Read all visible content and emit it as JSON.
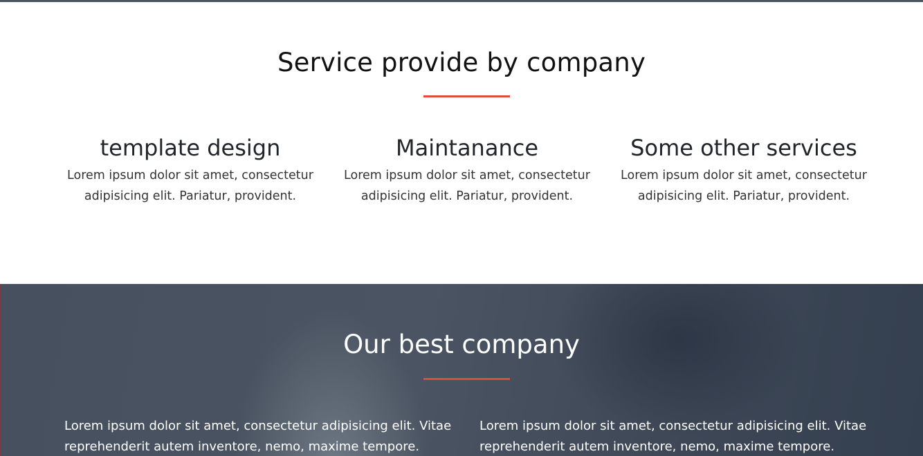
{
  "colors": {
    "accent": "#e04b3a",
    "dark_band": "#46505e",
    "top_border": "#4b5560"
  },
  "services": {
    "title": "Service provide by company",
    "items": [
      {
        "title": "template design",
        "text": "Lorem ipsum dolor sit amet, consectetur adipisicing elit. Pariatur, provident."
      },
      {
        "title": "Maintanance",
        "text": "Lorem ipsum dolor sit amet, consectetur adipisicing elit. Pariatur, provident."
      },
      {
        "title": "Some other services",
        "text": "Lorem ipsum dolor sit amet, consectetur adipisicing elit. Pariatur, provident."
      }
    ]
  },
  "company": {
    "title": "Our best company",
    "columns": [
      "Lorem ipsum dolor sit amet, consectetur adipisicing elit. Vitae reprehenderit autem inventore, nemo, maxime tempore.",
      "Lorem ipsum dolor sit amet, consectetur adipisicing elit. Vitae reprehenderit autem inventore, nemo, maxime tempore."
    ]
  }
}
